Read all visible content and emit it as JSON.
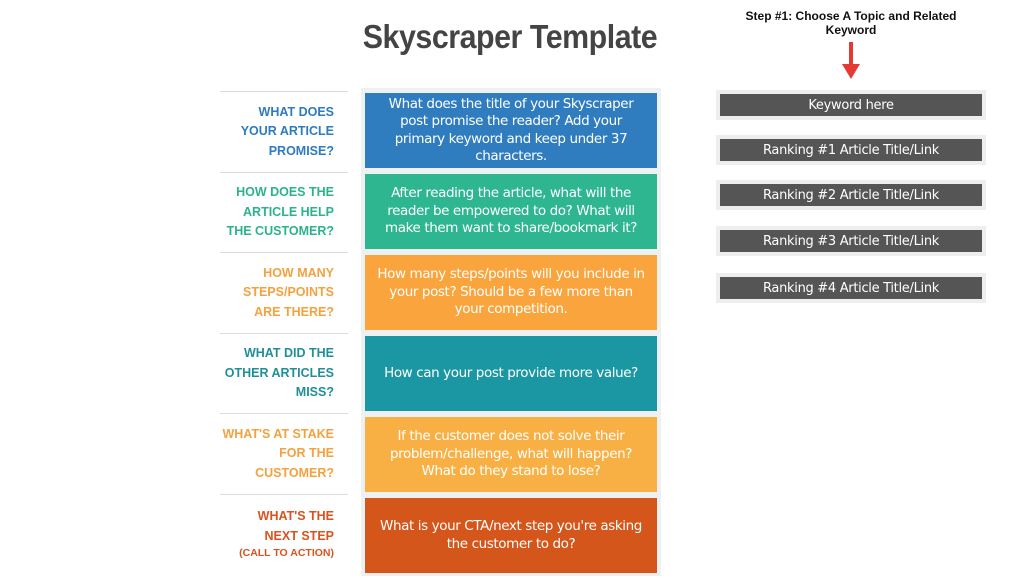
{
  "title": "Skyscraper Template",
  "step": {
    "title": "Step #1: Choose A Topic and Related Keyword",
    "arrow_icon": "down-arrow-icon",
    "arrow_color": "#e53935"
  },
  "right_boxes": [
    "Keyword here",
    "Ranking #1 Article Title/Link",
    "Ranking #2 Article Title/Link",
    "Ranking #3 Article Title/Link",
    "Ranking #4 Article Title/Link"
  ],
  "rows": [
    {
      "label_lines": [
        "WHAT DOES",
        "YOUR ARTICLE",
        "PROMISE?"
      ],
      "label_color": "#2e7bbf",
      "box_text": "What does the title of your Skyscraper post promise the reader? Add your primary keyword and keep under 37 characters.",
      "box_color": "#2f7cbf"
    },
    {
      "label_lines": [
        "HOW DOES THE",
        "ARTICLE HELP",
        "THE CUSTOMER?"
      ],
      "label_color": "#2bb38d",
      "box_text": "After reading the article, what will the reader be empowered to do? What will make them want to share/bookmark it?",
      "box_color": "#2db690"
    },
    {
      "label_lines": [
        "HOW MANY",
        "STEPS/POINTS",
        "ARE THERE?"
      ],
      "label_color": "#f5a13d",
      "box_text": "How many steps/points will you include in your post? Should be a few more than your competition.",
      "box_color": "#f9a43c"
    },
    {
      "label_lines": [
        "WHAT DID THE",
        "OTHER ARTICLES",
        "MISS?"
      ],
      "label_color": "#1f8f9a",
      "box_text": "How can your post provide more value?",
      "box_color": "#1a97a3"
    },
    {
      "label_lines": [
        "WHAT'S AT STAKE",
        "FOR THE",
        "CUSTOMER?"
      ],
      "label_color": "#f5a13d",
      "box_text": "If the customer does not solve their problem/challenge, what will happen? What do they stand to lose?",
      "box_color": "#f8b044"
    },
    {
      "label_lines": [
        "WHAT'S THE",
        "NEXT STEP",
        "(CALL TO ACTION)"
      ],
      "label_color": "#d9531e",
      "box_text": "What is your CTA/next step you're asking the customer to do?",
      "box_color": "#d4561b"
    }
  ]
}
